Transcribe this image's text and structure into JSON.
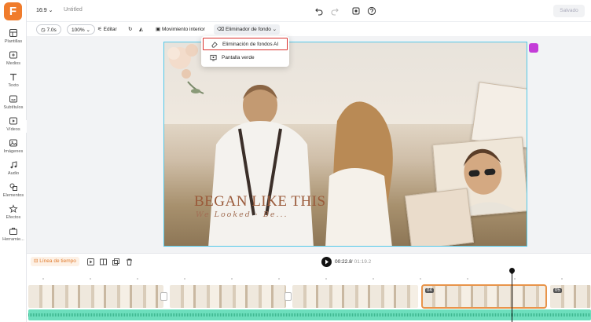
{
  "app": {
    "logo_letter": "F",
    "brand_color": "#f07c2c"
  },
  "sidebar": {
    "items": [
      {
        "label": "Plantillas",
        "icon": "templates-icon"
      },
      {
        "label": "Medios",
        "icon": "media-icon"
      },
      {
        "label": "Texto",
        "icon": "text-icon"
      },
      {
        "label": "Subtítulos",
        "icon": "subtitles-icon"
      },
      {
        "label": "Vídeos",
        "icon": "videos-icon"
      },
      {
        "label": "Imágenes",
        "icon": "images-icon"
      },
      {
        "label": "Audio",
        "icon": "audio-icon"
      },
      {
        "label": "Elementos",
        "icon": "elements-icon"
      },
      {
        "label": "Efectos",
        "icon": "effects-icon"
      },
      {
        "label": "Herramie...",
        "icon": "tools-icon"
      }
    ]
  },
  "topbar": {
    "aspect_ratio": "16:9",
    "title": "Untitled",
    "save_label": "Salvado"
  },
  "toolbar": {
    "duration": "7.0s",
    "zoom": "100%",
    "edit_label": "Editar",
    "motion_label": "Movimiento interior",
    "bg_remover_label": "Eliminador de fondo"
  },
  "dropdown": {
    "items": [
      {
        "label": "Eliminación de fondos AI",
        "icon": "eraser-icon",
        "highlighted": true
      },
      {
        "label": "Pantalla verde",
        "icon": "green-screen-icon",
        "highlighted": false
      }
    ]
  },
  "canvas": {
    "headline": "BEGAN LIKE THIS",
    "subline": "We Looked · Be..."
  },
  "timeline": {
    "tab_label": "Línea de tiempo",
    "current_time": "00:22.8",
    "total_time": "/ 01:19.2",
    "clip_numbers": [
      "04",
      "05"
    ],
    "selected_color": "#e8944a",
    "audio_color": "#6ddfbd"
  }
}
